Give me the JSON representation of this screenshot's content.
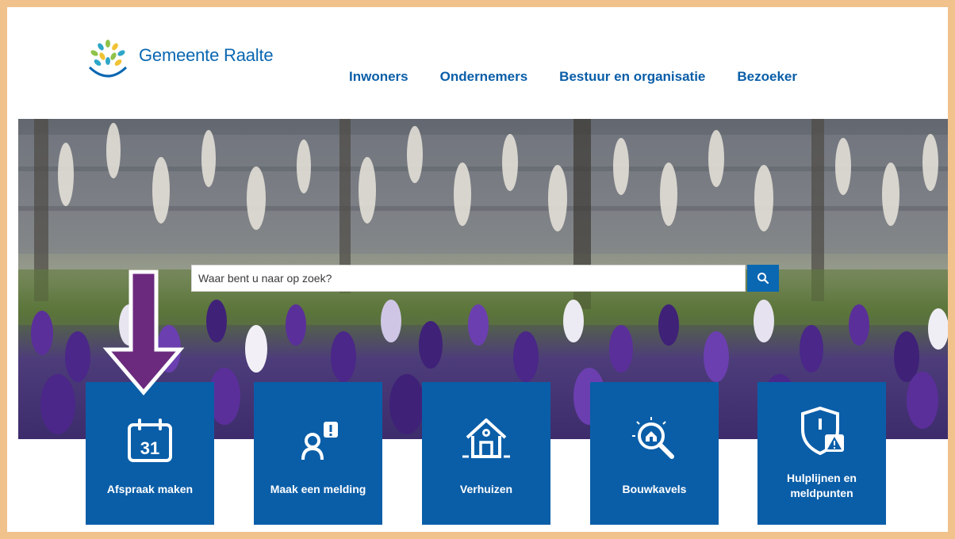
{
  "header": {
    "logo_text": "Gemeente Raalte",
    "nav": [
      "Inwoners",
      "Ondernemers",
      "Bestuur en organisatie",
      "Bezoeker"
    ]
  },
  "search": {
    "placeholder": "Waar bent u naar op zoek?"
  },
  "tiles": [
    {
      "label": "Afspraak maken",
      "icon": "calendar-icon",
      "calendar_day": "31"
    },
    {
      "label": "Maak een melding",
      "icon": "person-alert-icon"
    },
    {
      "label": "Verhuizen",
      "icon": "house-icon"
    },
    {
      "label": "Bouwkavels",
      "icon": "magnifier-house-icon"
    },
    {
      "label_line1": "Hulplijnen en",
      "label_line2": "meldpunten",
      "icon": "shield-warning-icon"
    }
  ],
  "colors": {
    "brand_blue": "#0a5ea8",
    "frame": "#f2c28c",
    "arrow": "#6b2a7e"
  }
}
